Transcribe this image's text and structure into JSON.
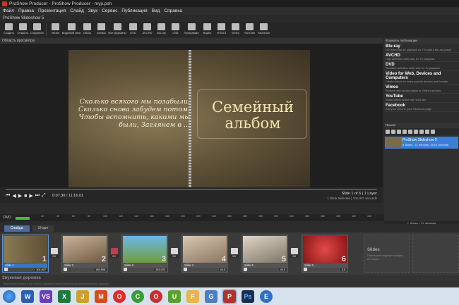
{
  "window": {
    "title": "ProShow Producer - ProShow Producer - myp.psh"
  },
  "menu": [
    "Файл",
    "Правка",
    "Презентация",
    "Слайд",
    "Звук",
    "Сервис",
    "Публикация",
    "Вид",
    "Справка"
  ],
  "show_name": "ProShow Slideshow 5",
  "toolbar": [
    "Создать",
    "Открыть",
    "Сохранить",
    "Меню",
    "Видимый знак",
    "Обзор",
    "Запись",
    "Все форматы",
    "DVD",
    "AVCHD",
    "Blu-ray",
    "USB",
    "Программа",
    "Видео",
    "HTML5",
    "Vimeo",
    "YouTube",
    "Facebook"
  ],
  "preview": {
    "header": "Область просмотра",
    "poem": "Сколько всякого мы позабыли. Сколько снова забудем потом. Чтобы вспомнить, какими мы были, Заглянем в ...",
    "title": "Семейный альбом"
  },
  "player": {
    "time": "0:07.30 / 11:16.01",
    "slide_info": "Slide 1 of 6  |  1 Layer",
    "selection_info": "1 Slide Selected  |  101.027 seconds"
  },
  "publish": {
    "header": "Форматы публикации",
    "items": [
      {
        "name": "Blu-ray",
        "desc": "HD video disc for playback on TVs with a Blu-ray player"
      },
      {
        "name": "AVCHD",
        "desc": "High definition video disc for TV playback"
      },
      {
        "name": "DVD",
        "desc": "Standard definition video disc for TV playback"
      },
      {
        "name": "Video for Web, Devices and Computers",
        "desc": "Create videos for many popular devices and formats"
      },
      {
        "name": "Vimeo",
        "desc": "Produce and upload videos to Vimeo's servers"
      },
      {
        "name": "YouTube",
        "desc": "Share videos online with YouTube"
      },
      {
        "name": "Facebook",
        "desc": "Add your show to your Facebook page"
      }
    ]
  },
  "project": {
    "header": "Проект",
    "show": {
      "name": "ProShow Slideshow 5",
      "desc": "6 Slides - 11 minutes, 16.01 seconds"
    },
    "footer": "1 Show - 11 minutes"
  },
  "timeline": {
    "dvd_label": "DVD",
    "ticks": [
      "0",
      "20",
      "40",
      "60",
      "80",
      "100",
      "120",
      "140",
      "160",
      "180",
      "200",
      "220",
      "240",
      "260",
      "280",
      "300",
      "320",
      "340",
      "360",
      "380",
      "400",
      "420",
      "440",
      "460"
    ]
  },
  "tabs": {
    "slides": "Слайды",
    "other": "Shape"
  },
  "slides": [
    {
      "label": "Slide 1",
      "num": "1",
      "duration": "101.027",
      "transition": "3.0"
    },
    {
      "label": "Slide 2",
      "num": "2",
      "duration": "166.896",
      "transition": "2.0"
    },
    {
      "label": "Slide 3",
      "num": "3",
      "duration": "263.022",
      "transition": "3.0"
    },
    {
      "label": "Slide 4",
      "num": "4",
      "duration": "44.0",
      "transition": "2.6"
    },
    {
      "label": "Slide 5",
      "num": "5",
      "duration": "44.0",
      "transition": "2.8"
    },
    {
      "label": "Slide 6",
      "num": "6",
      "duration": "3.0",
      "transition": ""
    }
  ],
  "empty_slot": {
    "title": "Slides",
    "desc": "Перетащите сюда фотографии или видео"
  },
  "soundtrack": {
    "label": "Звуковая дорожка",
    "desc": "Перетащите музыку в эту область. Щелкните правой кнопкой для дополнительных функций."
  },
  "taskbar": [
    "Пуск",
    "W",
    "VS",
    "X",
    "J",
    "M",
    "O",
    "C",
    "O",
    "U",
    "F",
    "G",
    "P",
    "Ps",
    "E"
  ]
}
